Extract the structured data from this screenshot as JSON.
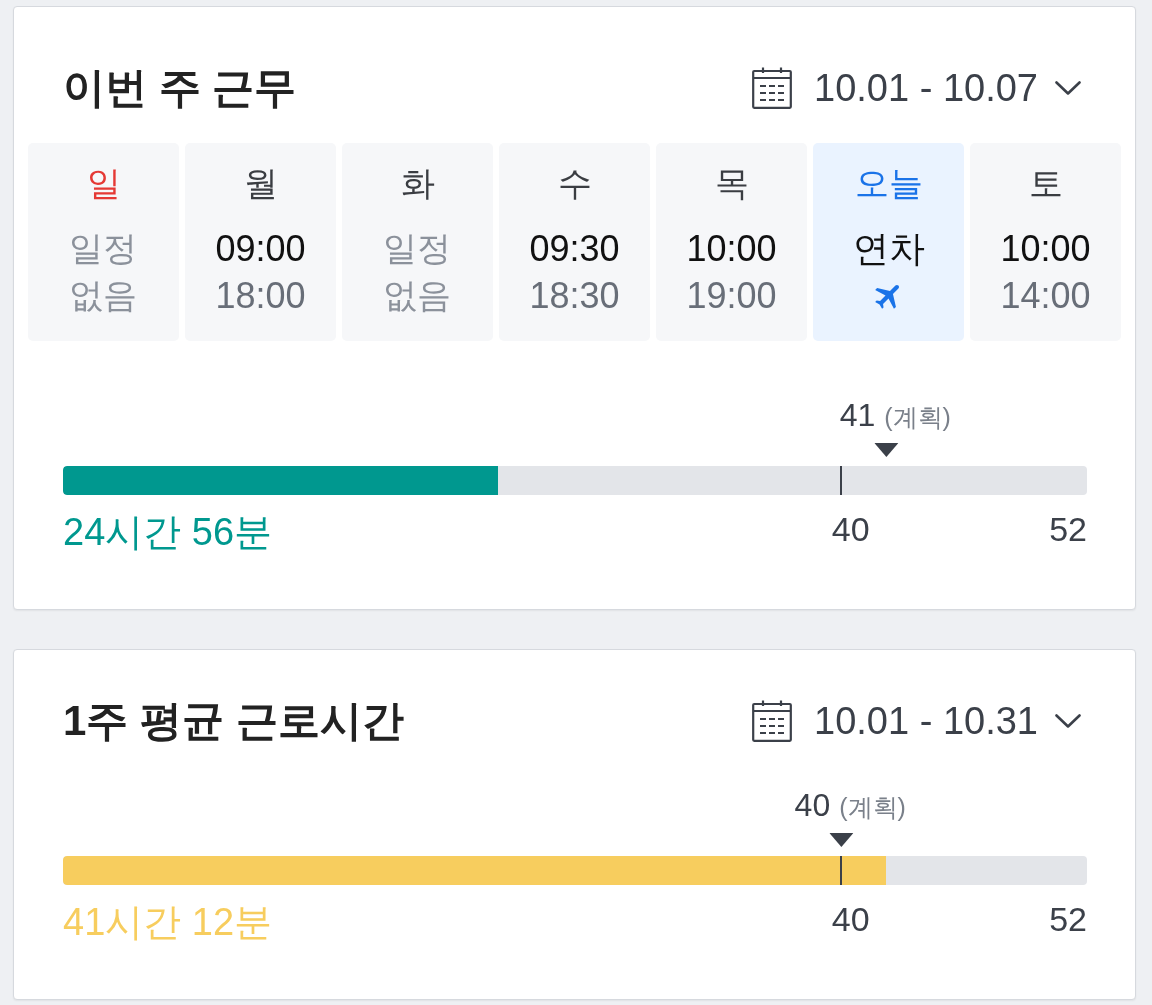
{
  "cards": [
    {
      "title": "이번 주 근무",
      "date_range": "10.01 - 10.07",
      "days": [
        {
          "label": "일",
          "holiday": true,
          "selected": false,
          "kind": "none",
          "text": "일정 없음"
        },
        {
          "label": "월",
          "holiday": false,
          "selected": false,
          "kind": "schedule",
          "start": "09:00",
          "end": "18:00"
        },
        {
          "label": "화",
          "holiday": false,
          "selected": false,
          "kind": "none",
          "text": "일정 없음"
        },
        {
          "label": "수",
          "holiday": false,
          "selected": false,
          "kind": "schedule",
          "start": "09:30",
          "end": "18:30"
        },
        {
          "label": "목",
          "holiday": false,
          "selected": false,
          "kind": "schedule",
          "start": "10:00",
          "end": "19:00"
        },
        {
          "label": "오늘",
          "holiday": false,
          "selected": true,
          "kind": "leave",
          "text": "연차"
        },
        {
          "label": "토",
          "holiday": false,
          "selected": false,
          "kind": "schedule",
          "start": "10:00",
          "end": "14:00"
        }
      ],
      "progress": {
        "total": "24시간 56분",
        "color": "#00988f",
        "level": 0.425,
        "plan": {
          "value": "41",
          "note": "(계획)",
          "level": 0.804
        },
        "ticks": [
          {
            "label": "40",
            "level": 0.76
          },
          {
            "label": "52",
            "level": 1
          }
        ]
      }
    },
    {
      "title": "1주 평균 근로시간",
      "date_range": "10.01 - 10.31",
      "progress": {
        "total": "41시간 12분",
        "color": "#f7cd5e",
        "level": 0.804,
        "plan": {
          "value": "40",
          "note": "(계획)",
          "level": 0.76
        },
        "ticks": [
          {
            "label": "40",
            "level": 0.76
          },
          {
            "label": "52",
            "level": 1
          }
        ]
      }
    }
  ]
}
